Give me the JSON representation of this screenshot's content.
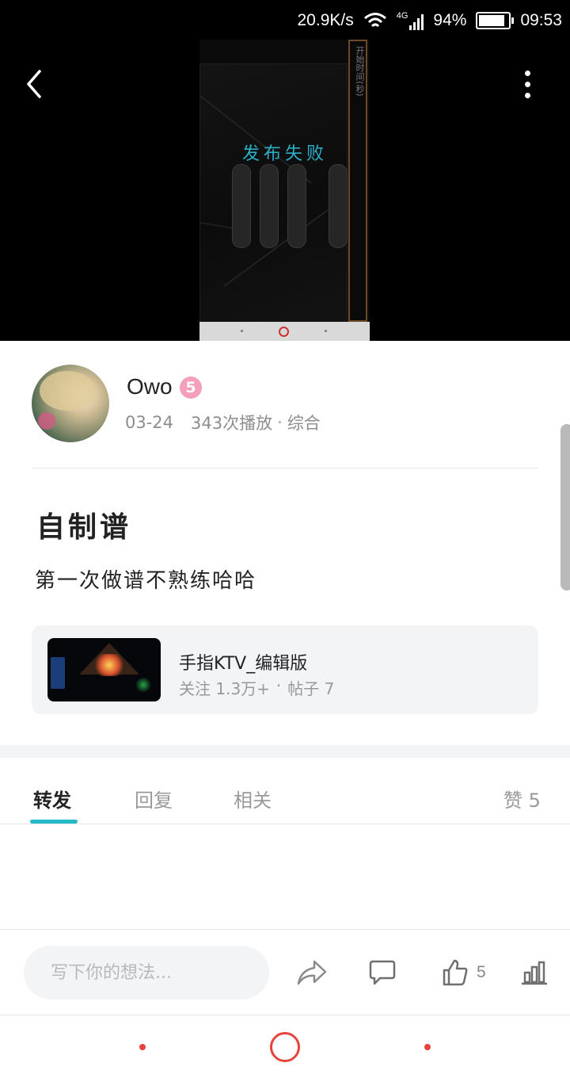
{
  "status_bar": {
    "net_speed": "20.9K/s",
    "network": "4G",
    "battery": "94%",
    "time": "09:53"
  },
  "video": {
    "overlay_text": "发布失败",
    "phone_sidebar_text": "开始时间(秒)"
  },
  "author": {
    "name": "Owo",
    "level": "5",
    "date": "03-24",
    "plays": "343次播放",
    "separator": "·",
    "category": "综合"
  },
  "post": {
    "title": "自制谱",
    "body": "第一次做谱不熟练哈哈"
  },
  "topic": {
    "name": "手指KTV_编辑版",
    "followers": "关注 1.3万+",
    "separator": "·",
    "posts": "帖子 7"
  },
  "tabs": {
    "items": [
      {
        "label": "转发",
        "active": true
      },
      {
        "label": "回复",
        "active": false
      },
      {
        "label": "相关",
        "active": false
      }
    ],
    "likes_label": "赞 5"
  },
  "action_bar": {
    "input_placeholder": "写下你的想法...",
    "like_count": "5"
  },
  "colors": {
    "accent": "#25b9c6",
    "overlay_text": "#2bb0c7",
    "nav": "#e8423d",
    "level_badge": "#f4a0bd"
  },
  "icons": [
    "back-arrow-icon",
    "more-vertical-icon",
    "share-icon",
    "comment-icon",
    "thumbs-up-icon",
    "stats-icon",
    "wifi-icon",
    "signal-icon",
    "battery-icon"
  ]
}
